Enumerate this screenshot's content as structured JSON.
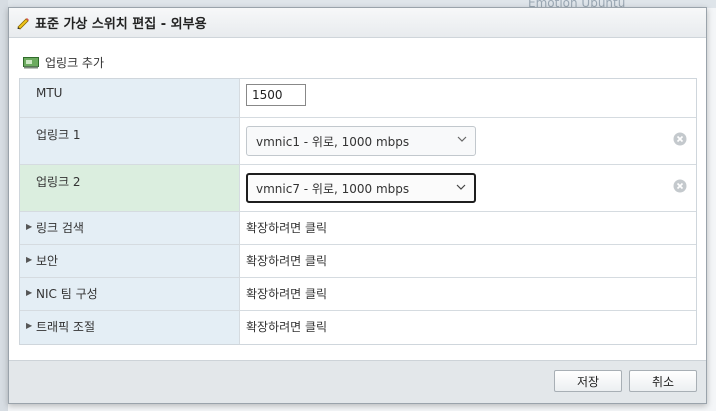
{
  "background": {
    "text": "Emotion Ubuntu"
  },
  "dialog": {
    "title": "표준 가상 스위치 편집 - 외부용",
    "section": {
      "icon": "nic-icon",
      "label": "업링크 추가"
    }
  },
  "rows": {
    "mtu": {
      "label": "MTU",
      "value": "1500"
    },
    "uplink1": {
      "label": "업링크 1",
      "selected": "vmnic1 - 위로, 1000 mbps"
    },
    "uplink2": {
      "label": "업링크 2",
      "selected": "vmnic7 - 위로, 1000 mbps"
    },
    "link_discovery": {
      "label": "링크 검색",
      "value": "확장하려면 클릭"
    },
    "security": {
      "label": "보안",
      "value": "확장하려면 클릭"
    },
    "nic_teaming": {
      "label": "NIC 팀 구성",
      "value": "확장하려면 클릭"
    },
    "traffic_shaping": {
      "label": "트래픽 조절",
      "value": "확장하려면 클릭"
    }
  },
  "footer": {
    "save_label": "저장",
    "cancel_label": "취소"
  },
  "colors": {
    "label_bg": "#e4eef5",
    "active_label_bg": "#dbeedf",
    "footer_bg": "#e3e7ea"
  }
}
